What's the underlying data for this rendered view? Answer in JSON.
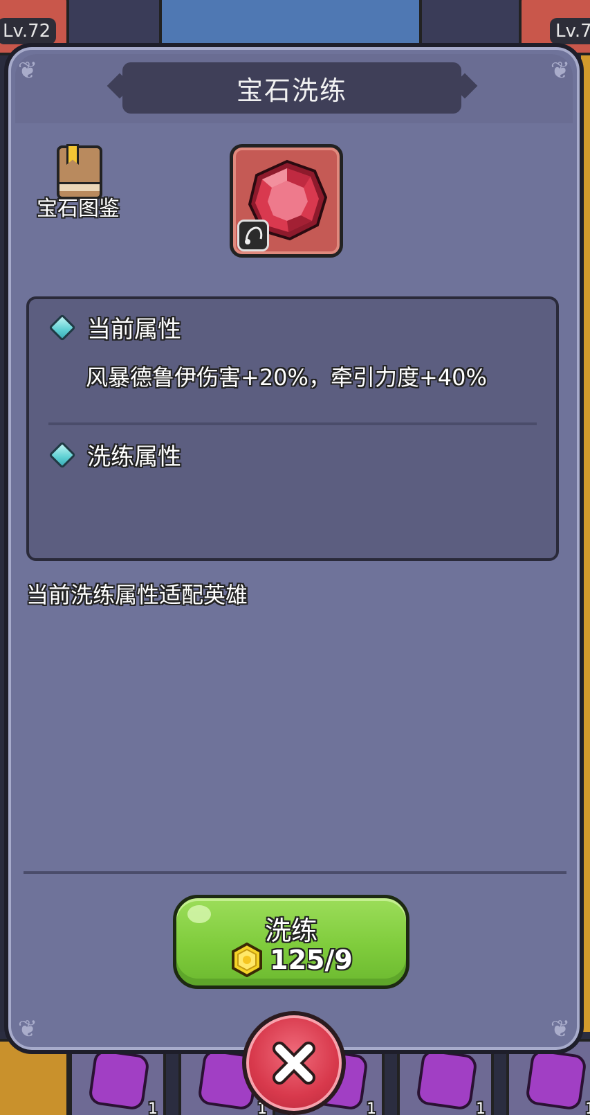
{
  "background": {
    "level_left": "Lv.72",
    "level_right": "Lv.7",
    "slot_counts": [
      "1",
      "1",
      "1",
      "1",
      "1"
    ]
  },
  "dialog": {
    "title": "宝石洗练",
    "codex_label": "宝石图鉴",
    "gem": {
      "icon": "red-gem-icon",
      "color": "#d9394f",
      "type_badge_icon": "hook-icon"
    },
    "current_attr": {
      "title": "当前属性",
      "value": "风暴德鲁伊伤害+20%，牵引力度+40%"
    },
    "refine_attr": {
      "title": "洗练属性",
      "value": ""
    },
    "hint": "当前洗练属性适配英雄",
    "refine_button": {
      "label": "洗练",
      "cost": "125/9",
      "cost_icon": "gold-coin-icon"
    },
    "close_icon": "close-icon"
  },
  "colors": {
    "panel": "#6f739a",
    "button_green": "#7fcc3c",
    "close_red": "#d8394c",
    "attr_diamond": "#5fd0d3"
  }
}
